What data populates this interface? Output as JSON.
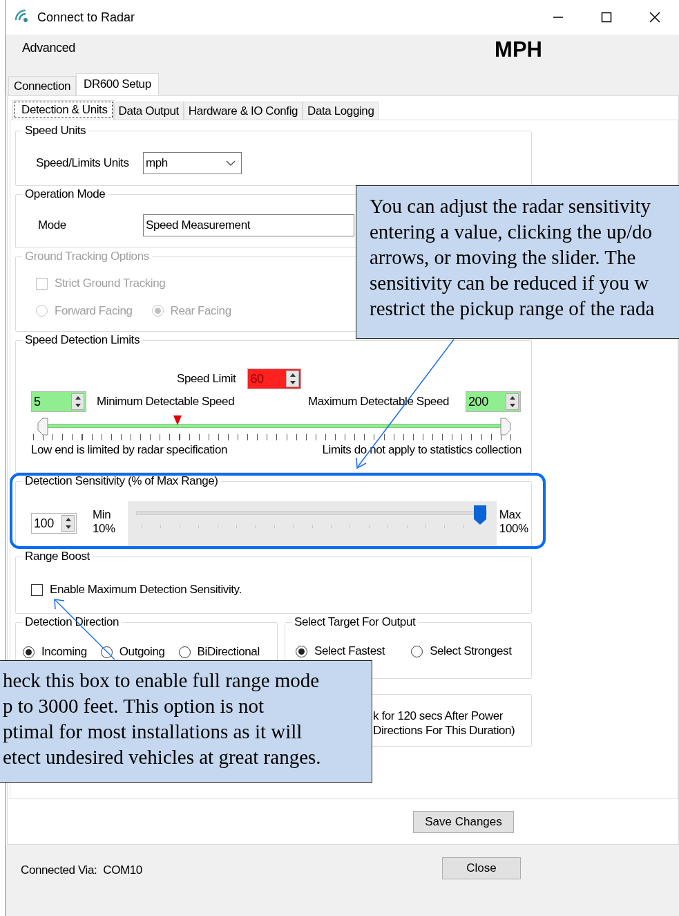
{
  "window": {
    "title": "Connect to Radar"
  },
  "menu": [
    {
      "label": "Advanced"
    }
  ],
  "units_badge": "MPH",
  "tabs": [
    {
      "label": "Connection",
      "selected": false
    },
    {
      "label": "DR600 Setup",
      "selected": true
    }
  ],
  "subtabs": [
    {
      "label": "Detection & Units",
      "selected": true
    },
    {
      "label": "Data Output",
      "selected": false
    },
    {
      "label": "Hardware & IO Config",
      "selected": false
    },
    {
      "label": "Data Logging",
      "selected": false
    }
  ],
  "speed_units": {
    "title": "Speed Units",
    "label": "Speed/Limits Units",
    "value": "mph"
  },
  "operation_mode": {
    "title": "Operation Mode",
    "label": "Mode",
    "value": "Speed Measurement"
  },
  "ground_tracking": {
    "title": "Ground Tracking Options",
    "disabled": true,
    "strict": {
      "label": "Strict Ground Tracking",
      "checked": false
    },
    "facing": [
      {
        "label": "Forward Facing",
        "selected": false
      },
      {
        "label": "Rear Facing",
        "selected": true
      }
    ]
  },
  "speed_limits": {
    "title": "Speed Detection Limits",
    "speed_limit": {
      "label": "Speed Limit",
      "value": "60"
    },
    "minimum": {
      "label": "Minimum Detectable Speed",
      "value": "5"
    },
    "maximum": {
      "label": "Maximum Detectable Speed",
      "value": "200"
    },
    "slider": {
      "low": {
        "level": 0.02
      },
      "high": {
        "level": 0.98
      },
      "limit": {
        "level": 0.3
      }
    },
    "notes": [
      "Low end is limited by radar specification",
      "Limits do not apply to statistics collection"
    ]
  },
  "sensitivity": {
    "title": "Detection Sensitivity (% of Max Range)",
    "value": "100",
    "min_label": "Min",
    "min_value": "10%",
    "max_label": "Max",
    "max_value": "100%",
    "slider": {
      "level": 1.0
    },
    "highlighted": true
  },
  "range_boost": {
    "title": "Range Boost",
    "checkbox": {
      "label": "Enable Maximum Detection Sensitivity.",
      "checked": false
    }
  },
  "direction": {
    "title": "Detection Direction",
    "options": [
      {
        "label": "Incoming",
        "selected": true
      },
      {
        "label": "Outgoing",
        "selected": false
      },
      {
        "label": "BiDirectional",
        "selected": false
      }
    ]
  },
  "target": {
    "title": "Select Target For Output",
    "options": [
      {
        "label": "Select Fastest",
        "selected": true
      },
      {
        "label": "Select Strongest",
        "selected": false
      }
    ]
  },
  "startup": {
    "lines": [
      "k for 120 secs After Power",
      "Directions For This Duration)"
    ]
  },
  "save_button": "Save Changes",
  "status": {
    "label": "Connected Via:",
    "port": "COM10"
  },
  "close_button": "Close",
  "callouts": [
    {
      "lines": [
        "You can adjust the radar sensitivity",
        "entering a value, clicking the up/do",
        "arrows, or moving the slider.  The",
        "sensitivity can be reduced if you w",
        "restrict the pickup range of the rada"
      ]
    },
    {
      "lines": [
        "heck this box to enable full range mode",
        "p to 3000 feet. This option is not",
        "ptimal for most installations as it will",
        "etect undesired vehicles at great ranges."
      ]
    }
  ]
}
